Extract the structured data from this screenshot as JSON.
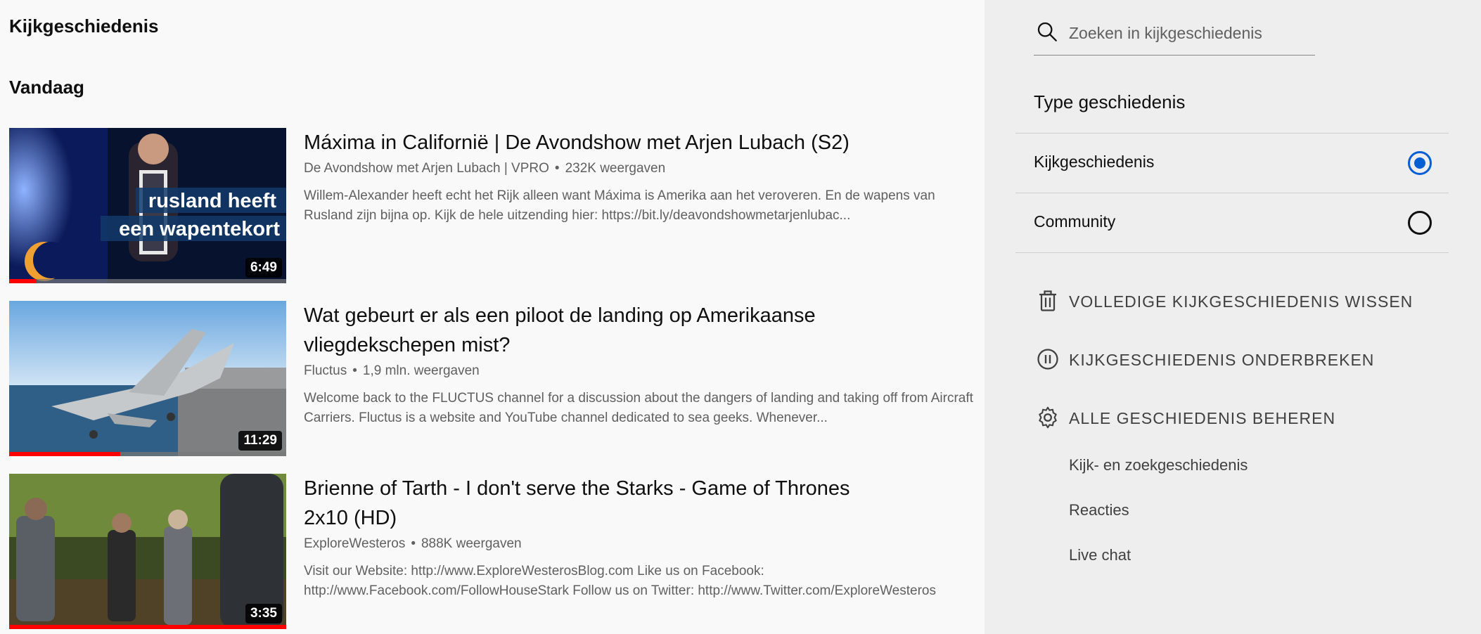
{
  "page": {
    "title": "Kijkgeschiedenis",
    "section": "Vandaag"
  },
  "videos": [
    {
      "title": "Máxima in Californië | De Avondshow met Arjen Lubach (S2)",
      "channel": "De Avondshow met Arjen Lubach | VPRO",
      "views": "232K weergaven",
      "description": "Willem-Alexander heeft echt het Rijk alleen want Máxima is Amerika aan het veroveren. En de wapens van Rusland zijn bijna op. Kijk de hele uitzending hier: https://bit.ly/deavondshowmetarjenlubac...",
      "duration": "6:49",
      "progress": 0.1,
      "thumb_text_1": "rusland heeft",
      "thumb_text_2": "een wapentekort"
    },
    {
      "title": "Wat gebeurt er als een piloot de landing op Amerikaanse vliegdekschepen mist?",
      "channel": "Fluctus",
      "views": "1,9 mln. weergaven",
      "description": "Welcome back to the FLUCTUS channel for a discussion about the dangers of landing and taking off from Aircraft Carriers. Fluctus is a website and YouTube channel dedicated to sea geeks. Whenever...",
      "duration": "11:29",
      "progress": 0.4
    },
    {
      "title": "Brienne of Tarth - I don't serve the Starks - Game of Thrones 2x10 (HD)",
      "channel": "ExploreWesteros",
      "views": "888K weergaven",
      "description": "Visit our Website: http://www.ExploreWesterosBlog.com Like us on Facebook: http://www.Facebook.com/FollowHouseStark Follow us on Twitter: http://www.Twitter.com/ExploreWesteros",
      "duration": "3:35",
      "progress": 1.0
    }
  ],
  "sidebar": {
    "search_placeholder": "Zoeken in kijkgeschiedenis",
    "type_title": "Type geschiedenis",
    "types": [
      {
        "label": "Kijkgeschiedenis",
        "selected": true
      },
      {
        "label": "Community",
        "selected": false
      }
    ],
    "actions": [
      {
        "label": "VOLLEDIGE KIJKGESCHIEDENIS WISSEN",
        "icon": "trash-icon"
      },
      {
        "label": "KIJKGESCHIEDENIS ONDERBREKEN",
        "icon": "pause-icon"
      },
      {
        "label": "ALLE GESCHIEDENIS BEHEREN",
        "icon": "gear-icon"
      }
    ],
    "links": [
      "Kijk- en zoekgeschiedenis",
      "Reacties",
      "Live chat"
    ]
  },
  "colors": {
    "accent": "#065fd4",
    "progress": "#ff0000",
    "sidebar_bg": "#eeeeee",
    "page_bg": "#f9f9f9"
  }
}
